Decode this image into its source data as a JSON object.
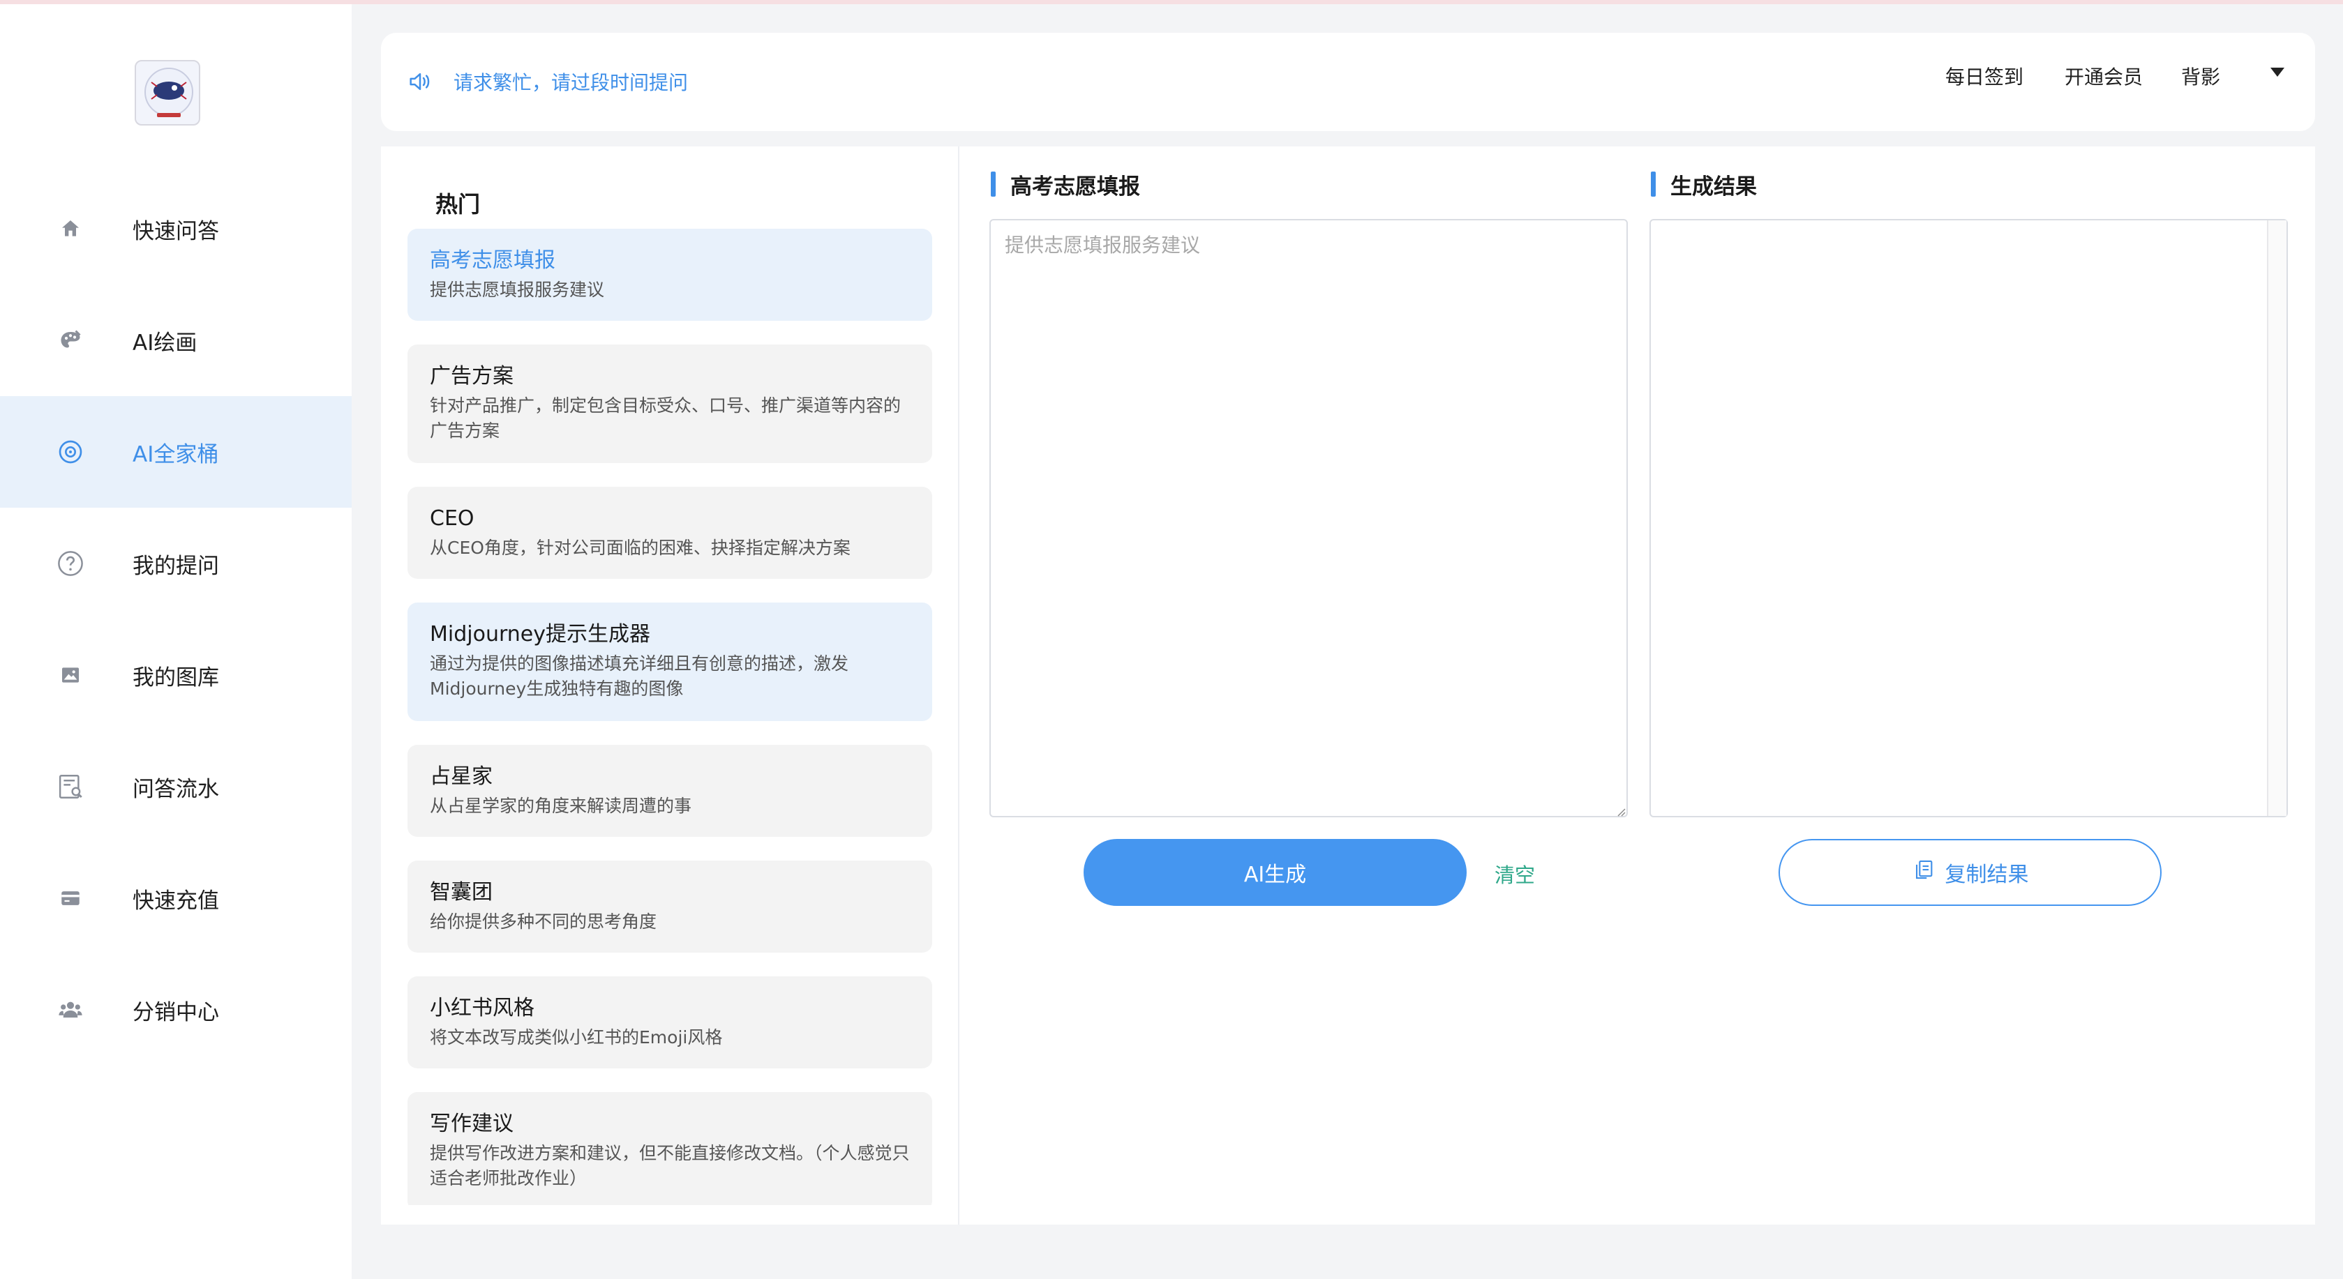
{
  "sidebar": {
    "items": [
      {
        "label": "快速问答",
        "icon": "home-icon"
      },
      {
        "label": "AI绘画",
        "icon": "palette-icon"
      },
      {
        "label": "AI全家桶",
        "icon": "compass-icon",
        "active": true
      },
      {
        "label": "我的提问",
        "icon": "question-icon"
      },
      {
        "label": "我的图库",
        "icon": "image-icon"
      },
      {
        "label": "问答流水",
        "icon": "receipt-search-icon"
      },
      {
        "label": "快速充值",
        "icon": "card-icon"
      },
      {
        "label": "分销中心",
        "icon": "users-icon"
      }
    ]
  },
  "header": {
    "notice": "请求繁忙，请过段时间提问",
    "daily_checkin": "每日签到",
    "membership": "开通会员",
    "user": "背影"
  },
  "main": {
    "hot_title": "热门",
    "cards": [
      {
        "title": "高考志愿填报",
        "desc": "提供志愿填报服务建议"
      },
      {
        "title": "广告方案",
        "desc": "针对产品推广，制定包含目标受众、口号、推广渠道等内容的广告方案"
      },
      {
        "title": "CEO",
        "desc": "从CEO角度，针对公司面临的困难、抉择指定解决方案"
      },
      {
        "title": "Midjourney提示生成器",
        "desc": "通过为提供的图像描述填充详细且有创意的描述，激发Midjourney生成独特有趣的图像"
      },
      {
        "title": "占星家",
        "desc": "从占星学家的角度来解读周遭的事"
      },
      {
        "title": "智囊团",
        "desc": "给你提供多种不同的思考角度"
      },
      {
        "title": "小红书风格",
        "desc": "将文本改写成类似小红书的Emoji风格"
      },
      {
        "title": "写作建议",
        "desc": "提供写作改进方案和建议，但不能直接修改文档。（个人感觉只适合老师批改作业）"
      }
    ],
    "input_title": "高考志愿填报",
    "input_placeholder": "提供志愿填报服务建议",
    "result_title": "生成结果",
    "generate_label": "AI生成",
    "clear_label": "清空",
    "copy_label": "复制结果"
  },
  "colors": {
    "accent": "#4596f0",
    "active_bg": "#e8f1fb",
    "clear": "#2fa88a"
  }
}
